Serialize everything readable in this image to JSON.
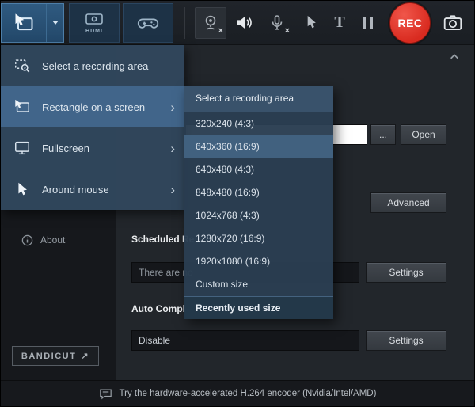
{
  "colors": {
    "accent_blue": "#41658a",
    "rec_red": "#d92b20",
    "menu_bg": "#31475d",
    "highlight_row": "#41617f"
  },
  "toolbar": {
    "rec_label": "REC",
    "text_tool_label": "T",
    "hdmi_label": "HDMI"
  },
  "icons": {
    "submenu_arrow": "›",
    "external_link_arrow": "↗",
    "disabled_x": "×"
  },
  "recording_menu": {
    "items": [
      {
        "label": "Select a recording area",
        "has_submenu": false,
        "selected": false
      },
      {
        "label": "Rectangle on a screen",
        "has_submenu": true,
        "selected": true
      },
      {
        "label": "Fullscreen",
        "has_submenu": true,
        "selected": false
      },
      {
        "label": "Around mouse",
        "has_submenu": true,
        "selected": false
      }
    ]
  },
  "size_submenu": {
    "header": "Select a recording area",
    "items": [
      {
        "label": "320x240 (4:3)",
        "highlighted": false
      },
      {
        "label": "640x360 (16:9)",
        "highlighted": true
      },
      {
        "label": "640x480 (4:3)",
        "highlighted": false
      },
      {
        "label": "848x480 (16:9)",
        "highlighted": false
      },
      {
        "label": "1024x768 (4:3)",
        "highlighted": false
      },
      {
        "label": "1280x720 (16:9)",
        "highlighted": false
      },
      {
        "label": "1920x1080 (16:9)",
        "highlighted": false
      },
      {
        "label": "Custom size",
        "highlighted": false
      },
      {
        "label": "Recently used size",
        "highlighted": false,
        "bold": true
      }
    ]
  },
  "sidebar": {
    "about_label": "About",
    "bandicut_label": "BANDICUT"
  },
  "main": {
    "output_field_value": "",
    "ellipsis_button": "...",
    "open_button": "Open",
    "advanced_button": "Advanced",
    "scheduled_heading": "Scheduled Re",
    "scheduled_value": "There are no",
    "scheduled_settings_button": "Settings",
    "autocomplete_heading": "Auto Compl",
    "autocomplete_value": "Disable",
    "autocomplete_settings_button": "Settings"
  },
  "statusbar": {
    "message": "Try the hardware-accelerated H.264 encoder (Nvidia/Intel/AMD)"
  }
}
